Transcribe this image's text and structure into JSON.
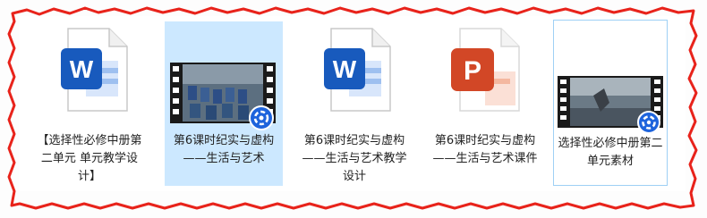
{
  "files": [
    {
      "name": "【选择性必修中册第二单元 单元教学设计】",
      "type": "word-document-icon",
      "state": "normal"
    },
    {
      "name": "第6课时纪实与虚构——生活与艺术",
      "type": "video-file-icon",
      "state": "selected"
    },
    {
      "name": "第6课时纪实与虚构——生活与艺术教学设计",
      "type": "word-document-icon",
      "state": "normal"
    },
    {
      "name": "第6课时纪实与虚构——生活与艺术课件",
      "type": "powerpoint-document-icon",
      "state": "normal"
    },
    {
      "name": "选择性必修中册第二单元素材",
      "type": "video-file-icon",
      "state": "hover"
    }
  ],
  "colors": {
    "border_red": "#e8231b",
    "selection": "#cce8ff",
    "word_blue": "#185abd",
    "ppt_orange": "#d24726",
    "video_badge": "#1e64dc"
  }
}
